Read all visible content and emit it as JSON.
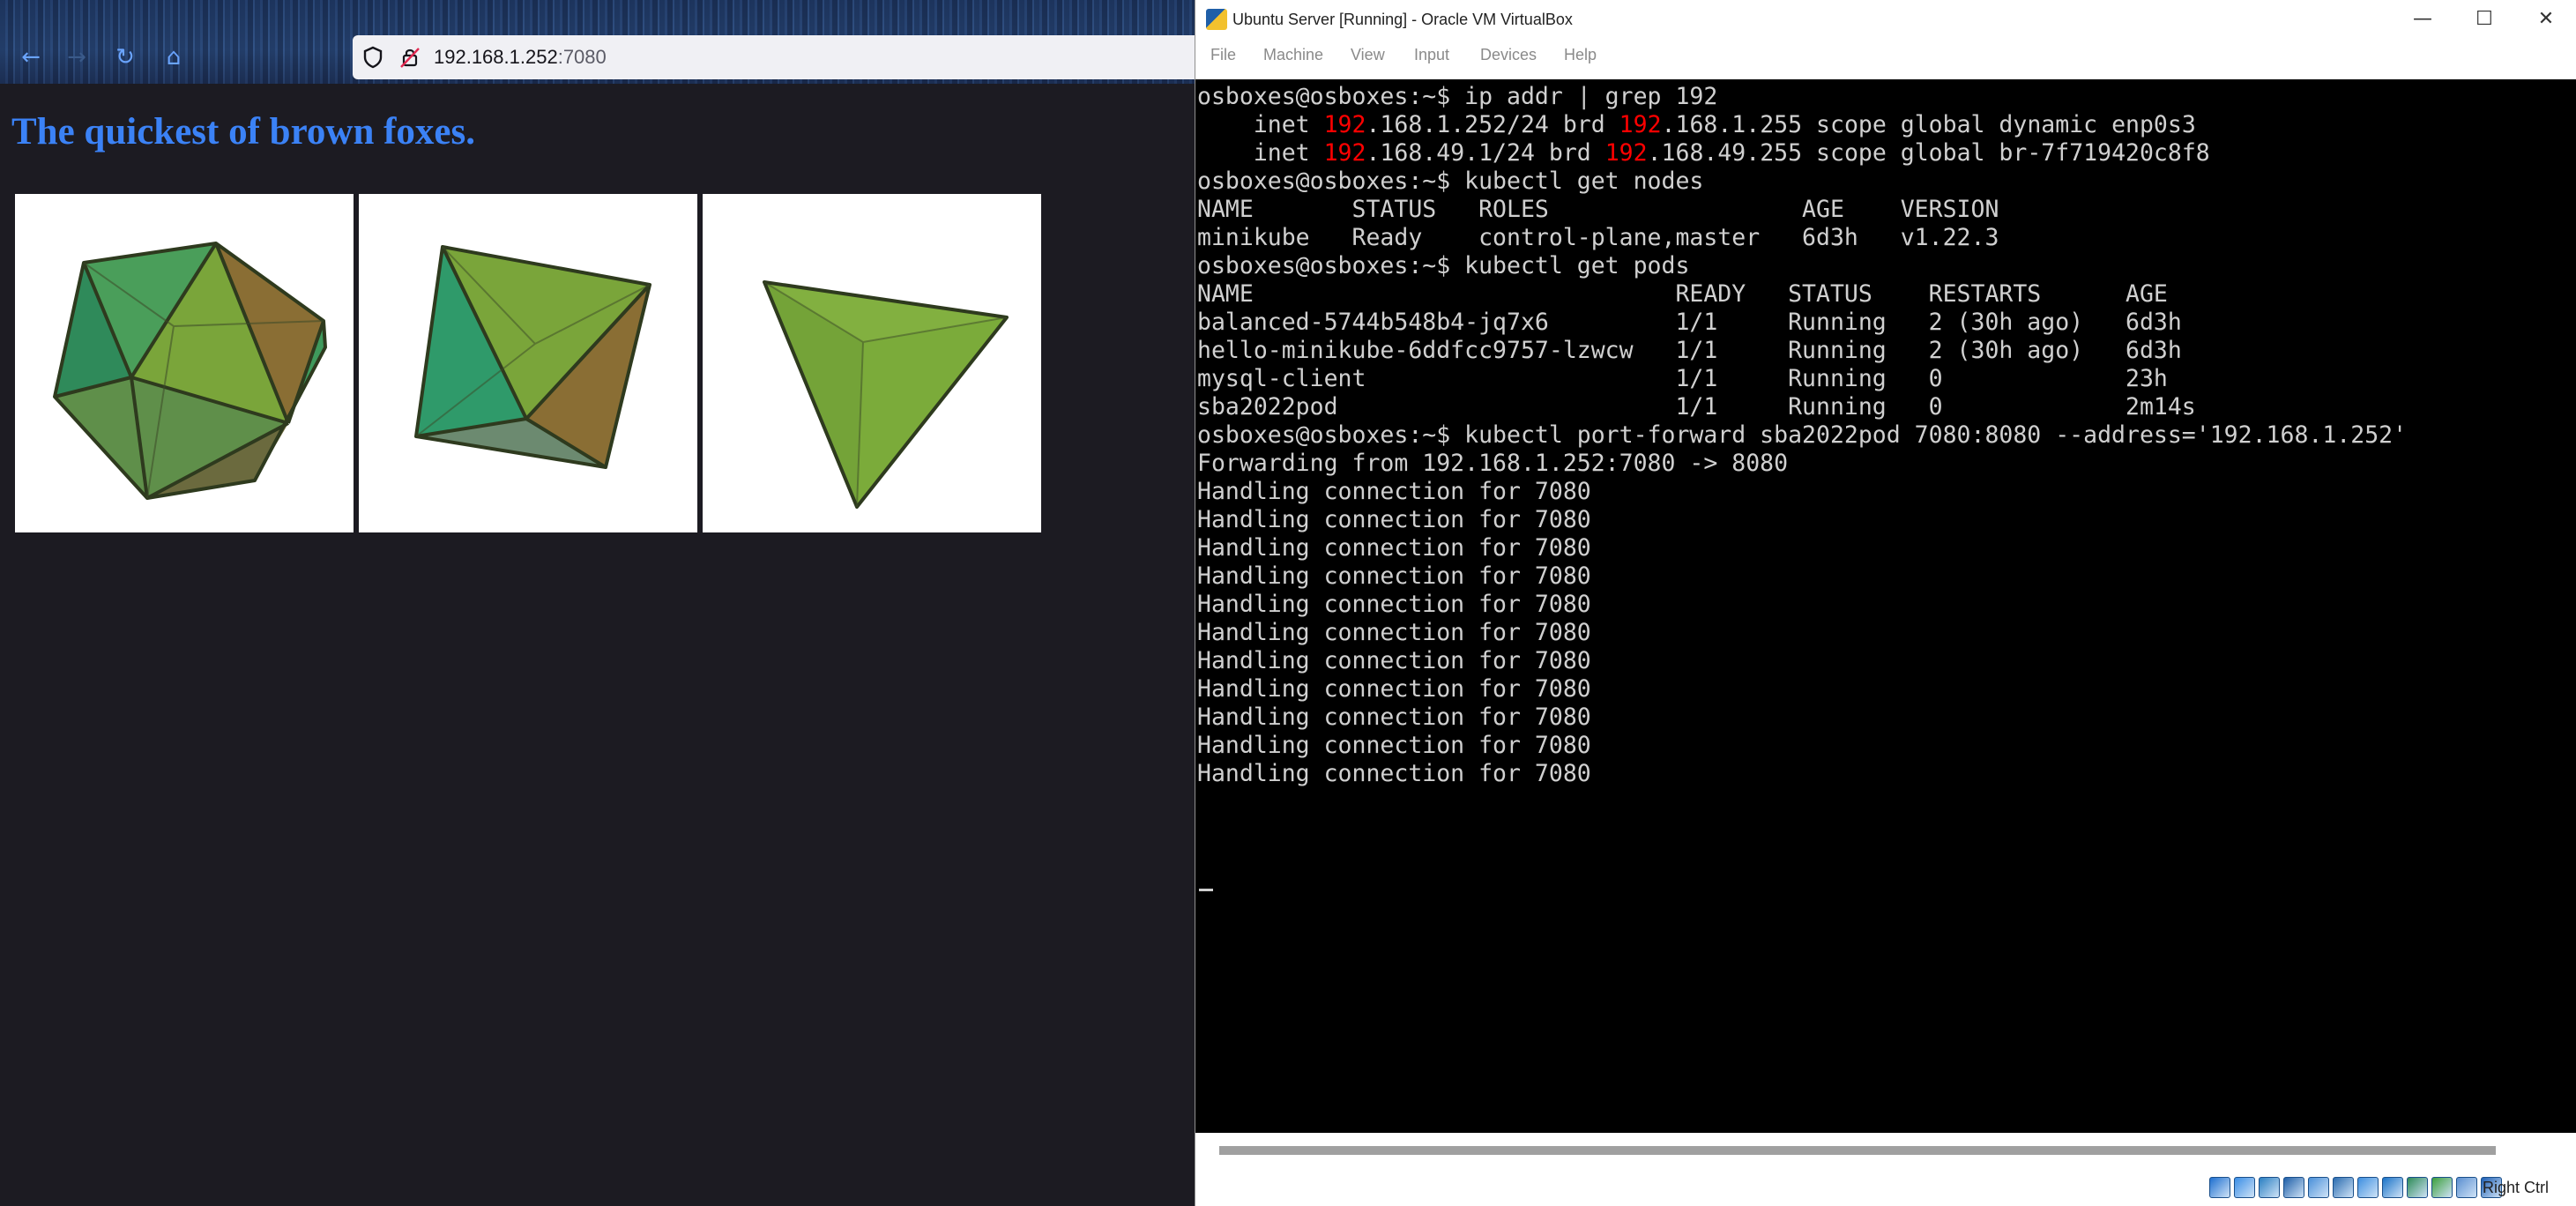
{
  "browser": {
    "nav": {
      "back_icon": "arrow-left-icon",
      "forward_icon": "arrow-right-icon",
      "reload_icon": "reload-icon",
      "home_icon": "home-icon"
    },
    "url_host": "192.168.1.252",
    "url_port": ":7080",
    "page_heading": "The quickest of brown foxes.",
    "images": [
      "icosahedron",
      "octahedron",
      "tetrahedron"
    ],
    "colors": {
      "heading": "#3b82f6",
      "page_bg": "#1c1b22"
    }
  },
  "vbox": {
    "title": "Ubuntu Server [Running] - Oracle VM VirtualBox",
    "window_controls": {
      "minimize": "—",
      "maximize": "☐",
      "close": "✕"
    },
    "menu": [
      "File",
      "Machine",
      "View",
      "Input",
      "Devices",
      "Help"
    ],
    "terminal_lines": [
      "osboxes@osboxes:~$ ip addr | grep 192",
      "    inet 192.168.1.252/24 brd 192.168.1.255 scope global dynamic enp0s3",
      "    inet 192.168.49.1/24 brd 192.168.49.255 scope global br-7f719420c8f8",
      "osboxes@osboxes:~$ kubectl get nodes",
      "NAME       STATUS   ROLES                  AGE    VERSION",
      "minikube   Ready    control-plane,master   6d3h   v1.22.3",
      "osboxes@osboxes:~$ kubectl get pods",
      "NAME                              READY   STATUS    RESTARTS      AGE",
      "balanced-5744b548b4-jq7x6         1/1     Running   2 (30h ago)   6d3h",
      "hello-minikube-6ddfcc9757-lzwcw   1/1     Running   2 (30h ago)   6d3h",
      "mysql-client                      1/1     Running   0             23h",
      "sba2022pod                        1/1     Running   0             2m14s",
      "osboxes@osboxes:~$ kubectl port-forward sba2022pod 7080:8080 --address='192.168.1.252'",
      "Forwarding from 192.168.1.252:7080 -> 8080",
      "Handling connection for 7080",
      "Handling connection for 7080",
      "Handling connection for 7080",
      "Handling connection for 7080",
      "Handling connection for 7080",
      "Handling connection for 7080",
      "Handling connection for 7080",
      "Handling connection for 7080",
      "Handling connection for 7080",
      "Handling connection for 7080",
      "Handling connection for 7080"
    ],
    "highlight_term": "192",
    "highlight_color": "#ff0000",
    "status_icons": [
      "harddisk-icon",
      "optical-drive-icon",
      "audio-icon",
      "network-icon",
      "usb-icon",
      "shared-folders-icon",
      "display-icon",
      "video-capture-icon",
      "recording-icon",
      "cpu-icon",
      "mouse-integration-icon",
      "host-key-arrow-icon"
    ],
    "host_key": "Right Ctrl"
  }
}
